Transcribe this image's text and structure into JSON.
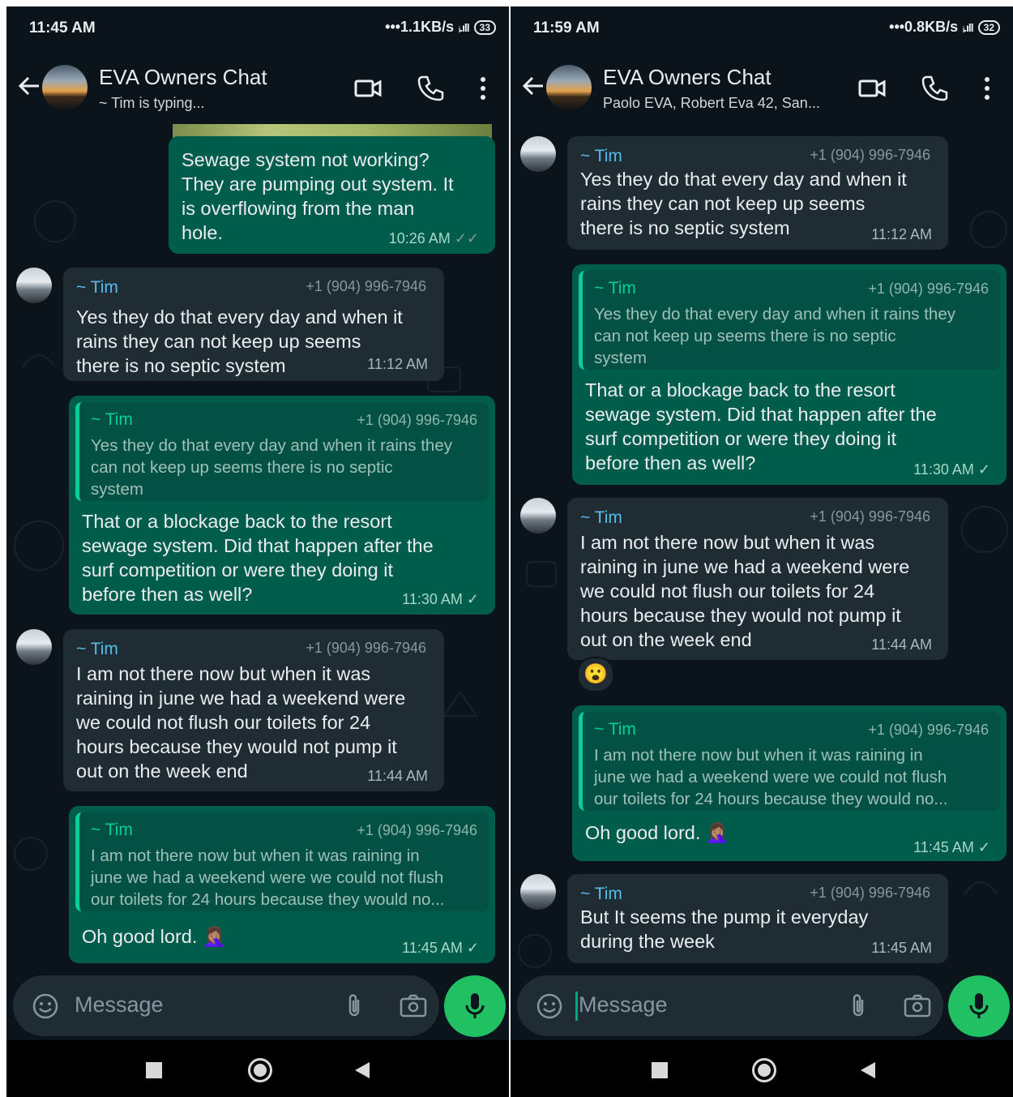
{
  "left": {
    "status": {
      "time": "11:45 AM",
      "net": "1.1KB/s",
      "battery": "33"
    },
    "header": {
      "title": "EVA Owners Chat",
      "subtitle": "~ Tim is typing..."
    },
    "messages": [
      {
        "type": "out",
        "text": "Sewage system not working?\nThey are pumping out system. It\nis overflowing from the man\nhole.",
        "time": "10:26 AM",
        "ticks": "✓✓"
      },
      {
        "type": "in",
        "sender": "~ Tim",
        "phone": "+1 (904) 996-7946",
        "text": "Yes they do that every day and when it\nrains they can not keep up seems\nthere is no septic system",
        "time": "11:12 AM"
      },
      {
        "type": "out_reply",
        "quote_sender": "~ Tim",
        "quote_phone": "+1 (904) 996-7946",
        "quote_text": "Yes they do that every day and when it rains they\ncan not keep up seems there is no septic\nsystem",
        "text": "That or a blockage back to the resort\nsewage system. Did that happen after the\nsurf competition or were they doing it\nbefore then as well?",
        "time": "11:30 AM",
        "ticks": "✓"
      },
      {
        "type": "in",
        "sender": "~ Tim",
        "phone": "+1 (904) 996-7946",
        "text": "I am not there now but when it was\nraining in june we had a weekend were\nwe could not flush our toilets for 24\nhours because they would not pump it\nout on the week end",
        "time": "11:44 AM"
      },
      {
        "type": "out_reply",
        "quote_sender": "~ Tim",
        "quote_phone": "+1 (904) 996-7946",
        "quote_text": "I am not there now but when it was raining in\njune we had a weekend were we could not flush\nour toilets for 24 hours because they would no...",
        "text": "Oh good lord. 🤦🏽‍♀️",
        "time": "11:45 AM",
        "ticks": "✓"
      }
    ],
    "input": {
      "placeholder": "Message"
    }
  },
  "right": {
    "status": {
      "time": "11:59 AM",
      "net": "0.8KB/s",
      "battery": "32"
    },
    "header": {
      "title": "EVA Owners Chat",
      "subtitle": "Paolo EVA, Robert Eva 42, San..."
    },
    "messages": [
      {
        "type": "in",
        "sender": "~ Tim",
        "phone": "+1 (904) 996-7946",
        "text": "Yes they do that every day and when it\nrains they can not keep up seems\nthere is no septic system",
        "time": "11:12 AM"
      },
      {
        "type": "out_reply",
        "quote_sender": "~ Tim",
        "quote_phone": "+1 (904) 996-7946",
        "quote_text": "Yes they do that every day and when it rains they\ncan not keep up seems there is no septic\nsystem",
        "text": "That or a blockage back to the resort\nsewage system. Did that happen after the\nsurf competition or were they doing it\nbefore then as well?",
        "time": "11:30 AM",
        "ticks": "✓"
      },
      {
        "type": "in",
        "sender": "~ Tim",
        "phone": "+1 (904) 996-7946",
        "text": "I am not there now but when it was\nraining in june we had a weekend were\nwe could not flush our toilets for 24\nhours because they would not pump it\nout on the week end",
        "time": "11:44 AM",
        "reaction": "😮"
      },
      {
        "type": "out_reply",
        "quote_sender": "~ Tim",
        "quote_phone": "+1 (904) 996-7946",
        "quote_text": "I am not there now but when it was raining in\njune we had a weekend were we could not flush\nour toilets for 24 hours because they would no...",
        "text": "Oh good lord. 🤦🏽‍♀️",
        "time": "11:45 AM",
        "ticks": "✓"
      },
      {
        "type": "in",
        "sender": "~ Tim",
        "phone": "+1 (904) 996-7946",
        "text": "But It seems the pump it everyday\nduring the week",
        "time": "11:45 AM"
      }
    ],
    "input": {
      "placeholder": "Message"
    }
  },
  "colors": {
    "incoming": "#202c33",
    "outgoing": "#005c4b",
    "accent": "#21c063",
    "sender": "#53bdeb"
  },
  "icons": [
    "back-arrow-icon",
    "video-call-icon",
    "voice-call-icon",
    "more-menu-icon",
    "emoji-icon",
    "attach-icon",
    "camera-icon",
    "mic-icon",
    "nav-recents-icon",
    "nav-home-icon",
    "nav-back-icon"
  ]
}
